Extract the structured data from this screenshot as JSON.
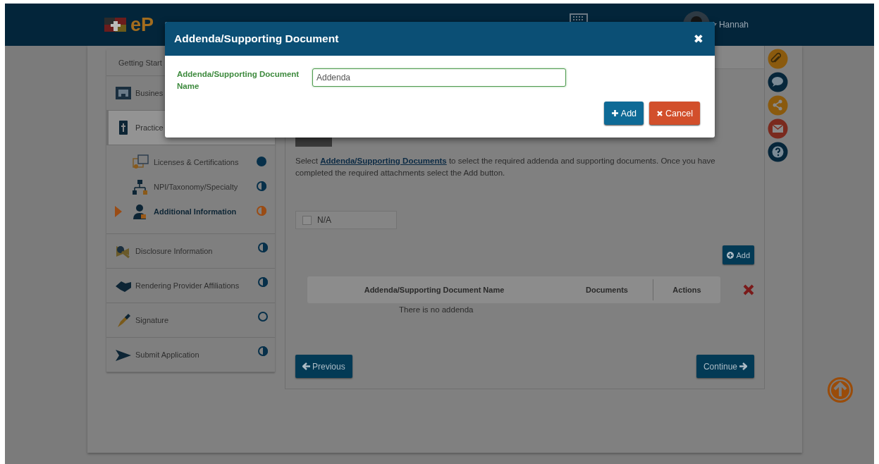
{
  "header": {
    "logo_text": "eP",
    "user_name": "Hannah"
  },
  "sidebar": {
    "items": [
      {
        "label": "Getting Start",
        "selected": false
      },
      {
        "label": "Busines",
        "selected": false
      },
      {
        "label": "Practice",
        "selected": true,
        "children": [
          {
            "label": "Licenses & Certifications",
            "selected": false,
            "kind": "complete"
          },
          {
            "label": "NPI/Taxonomy/Specialty",
            "selected": false,
            "kind": "partial"
          },
          {
            "label": "Additional Information",
            "selected": true,
            "kind": "partial"
          }
        ]
      },
      {
        "label": "Disclosure Information",
        "selected": false,
        "kind": "partial"
      },
      {
        "label": "Rendering Provider Affiliations",
        "selected": false,
        "kind": "partial"
      },
      {
        "label": "Signature",
        "selected": false,
        "kind": "empty"
      },
      {
        "label": "Submit Application",
        "selected": false,
        "kind": "partial"
      }
    ]
  },
  "content": {
    "instructions": {
      "before": "Select ",
      "link": "Addenda/Supporting Documents",
      "after": " to select the required addenda and supporting documents. Once you have completed the required attachments select the Add button."
    },
    "na_checkbox": {
      "label": "N/A",
      "checked": false
    },
    "add_button": "Add",
    "table": {
      "columns": [
        "Addenda/Supporting Document Name",
        "Documents",
        "Actions"
      ],
      "empty_text": "There is no addenda"
    },
    "previous_button": "Previous",
    "continue_button": "Continue"
  },
  "modal": {
    "title": "Addenda/Supporting Document",
    "close": "✖",
    "field_label": "Addenda/Supporting Document Name",
    "field_value": "Addenda",
    "buttons": [
      {
        "label": "Add",
        "kind": "primary"
      },
      {
        "label": "Cancel",
        "kind": "danger"
      }
    ]
  }
}
